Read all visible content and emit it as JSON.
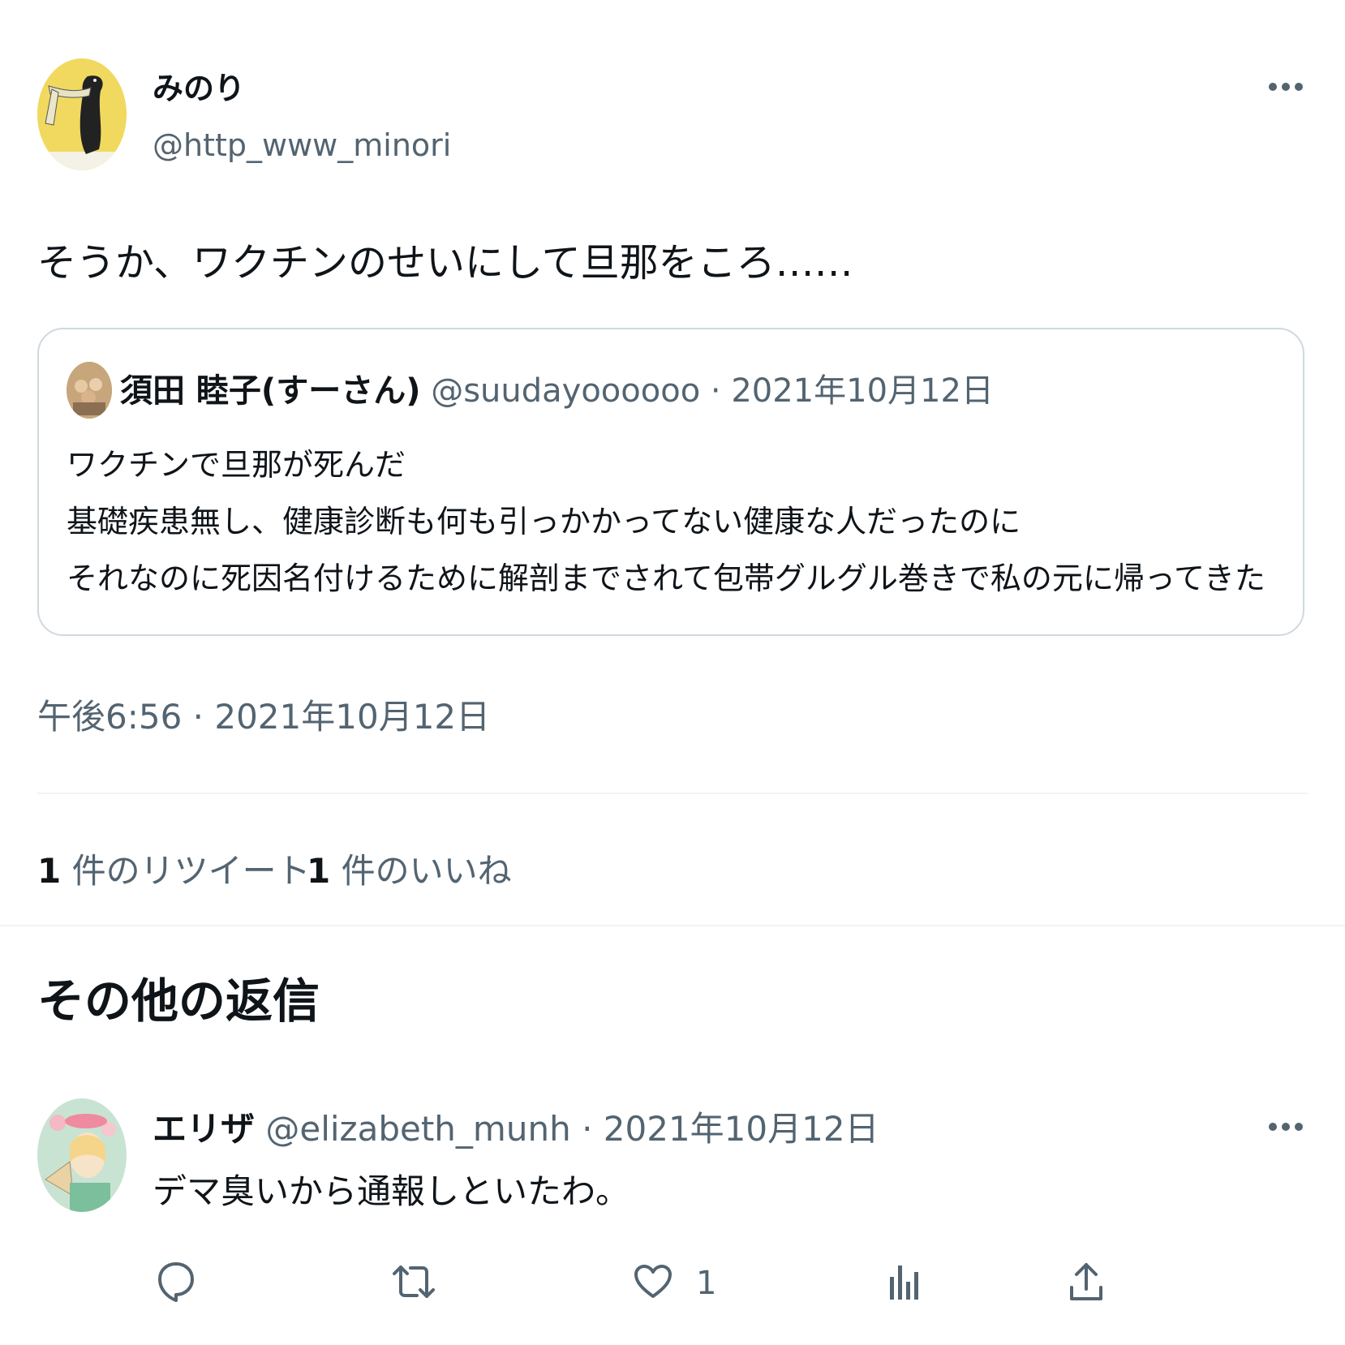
{
  "tweet": {
    "author_name": "みのり",
    "author_handle": "@http_www_minori",
    "text": "そうか、ワクチンのせいにして旦那をころ……",
    "timestamp": "午後6:56 · 2021年10月12日"
  },
  "quote": {
    "author_name": "須田 睦子(すーさん)",
    "author_handle": "@suudayoooooo",
    "separator": "·",
    "date": "2021年10月12日",
    "lines": [
      "ワクチンで旦那が死んだ",
      "基礎疾患無し、健康診断も何も引っかかってない健康な人だったのに",
      "それなのに死因名付けるために解剖までされて包帯グルグル巻きで私の元に帰ってきた"
    ]
  },
  "stats": {
    "retweet_count": "1",
    "retweet_label": "件のリツイート",
    "like_count": "1",
    "like_label": "件のいいね"
  },
  "replies_section": {
    "title": "その他の返信"
  },
  "reply": {
    "author_name": "エリザ",
    "author_handle": "@elizabeth_munh",
    "separator": "·",
    "date": "2021年10月12日",
    "text": "デマ臭いから通報しといたわ。",
    "like_count": "1"
  },
  "icons": {
    "more": "more-horizontal-icon",
    "reply": "reply-icon",
    "retweet": "retweet-icon",
    "like": "heart-icon",
    "views": "views-icon",
    "share": "share-icon"
  },
  "colors": {
    "text": "#0f1419",
    "muted": "#536471",
    "border": "#cfd9de",
    "divider": "#eff3f4"
  }
}
